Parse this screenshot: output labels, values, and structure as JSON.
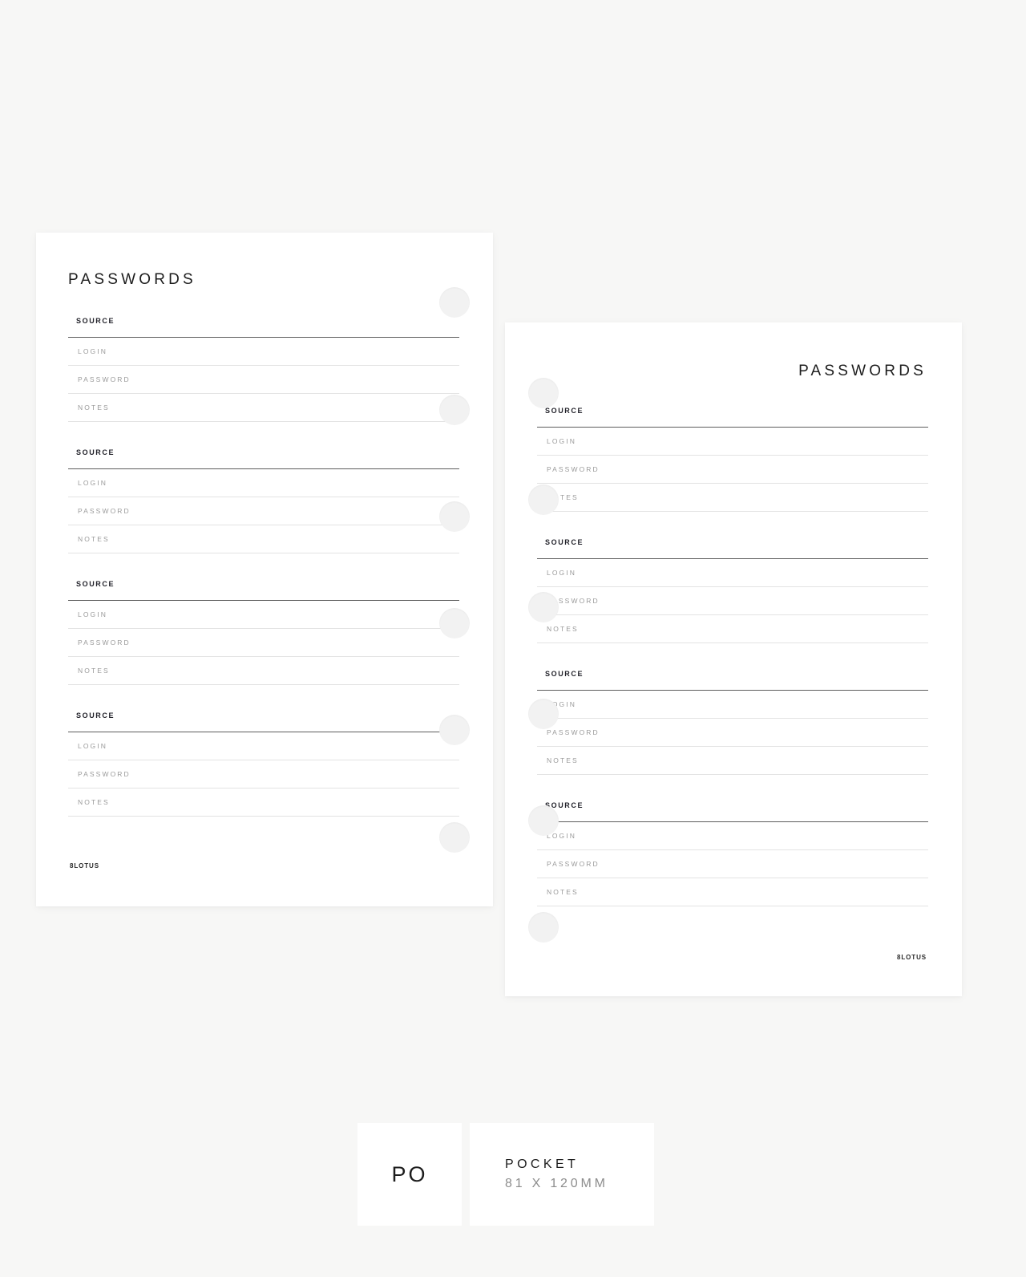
{
  "background_color": "#f7f7f6",
  "pages": [
    {
      "id": "left-page",
      "title": "PASSWORDS",
      "title_align": "left",
      "brand": "8LOTUS",
      "entries": [
        {
          "source": "SOURCE",
          "login": "LOGIN",
          "password": "PASSWORD",
          "notes": "NOTES"
        },
        {
          "source": "SOURCE",
          "login": "LOGIN",
          "password": "PASSWORD",
          "notes": "NOTES"
        },
        {
          "source": "SOURCE",
          "login": "LOGIN",
          "password": "PASSWORD",
          "notes": "NOTES"
        },
        {
          "source": "SOURCE",
          "login": "LOGIN",
          "password": "PASSWORD",
          "notes": "NOTES"
        }
      ]
    },
    {
      "id": "right-page",
      "title": "PASSWORDS",
      "title_align": "right",
      "brand": "8LOTUS",
      "entries": [
        {
          "source": "SOURCE",
          "login": "LOGIN",
          "password": "PASSWORD",
          "notes": "NOTES"
        },
        {
          "source": "SOURCE",
          "login": "LOGIN",
          "password": "PASSWORD",
          "notes": "NOTES"
        },
        {
          "source": "SOURCE",
          "login": "LOGIN",
          "password": "PASSWORD",
          "notes": "NOTES"
        },
        {
          "source": "SOURCE",
          "login": "LOGIN",
          "password": "PASSWORD",
          "notes": "NOTES"
        }
      ]
    }
  ],
  "size_label": {
    "code": "PO",
    "name": "POCKET",
    "dimensions": "81 X 120MM"
  }
}
